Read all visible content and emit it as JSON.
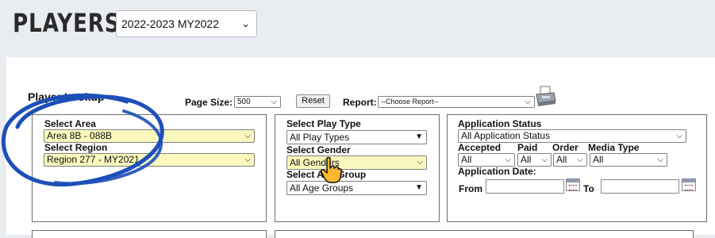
{
  "header": {
    "title": "PLAYERS",
    "season_value": "2022-2023 MY2022"
  },
  "lookup": {
    "title": "Player Lookup",
    "page_size_label": "Page Size:",
    "page_size_value": "500",
    "reset_label": "Reset",
    "report_label": "Report:",
    "report_value": "--Choose Report--"
  },
  "area": {
    "area_label": "Select Area",
    "area_value": "Area 8B - 088B",
    "region_label": "Select Region",
    "region_value": "Region 277 - MY2021"
  },
  "filters": {
    "play_type_label": "Select Play Type",
    "play_type_value": "All Play Types",
    "gender_label": "Select Gender",
    "gender_value": "All Genders",
    "age_group_label": "Select Age Group",
    "age_group_value": "All Age Groups"
  },
  "application": {
    "status_label": "Application Status",
    "status_value": "All Application Status",
    "accepted_label": "Accepted",
    "accepted_value": "All",
    "paid_label": "Paid",
    "paid_value": "All",
    "order_label": "Order",
    "order_value": "All",
    "media_type_label": "Media Type",
    "media_type_value": "All",
    "date_label": "Application Date:",
    "from_label": "From",
    "to_label": "To",
    "from_value": "",
    "to_value": ""
  },
  "colors": {
    "highlight_yellow": "#fbf8bd",
    "annotation_blue": "#1d4fb8",
    "cursor_orange": "#f5a623"
  },
  "icons": [
    "chevron-down-icon",
    "printer-icon",
    "calendar-icon",
    "hand-cursor-icon"
  ]
}
